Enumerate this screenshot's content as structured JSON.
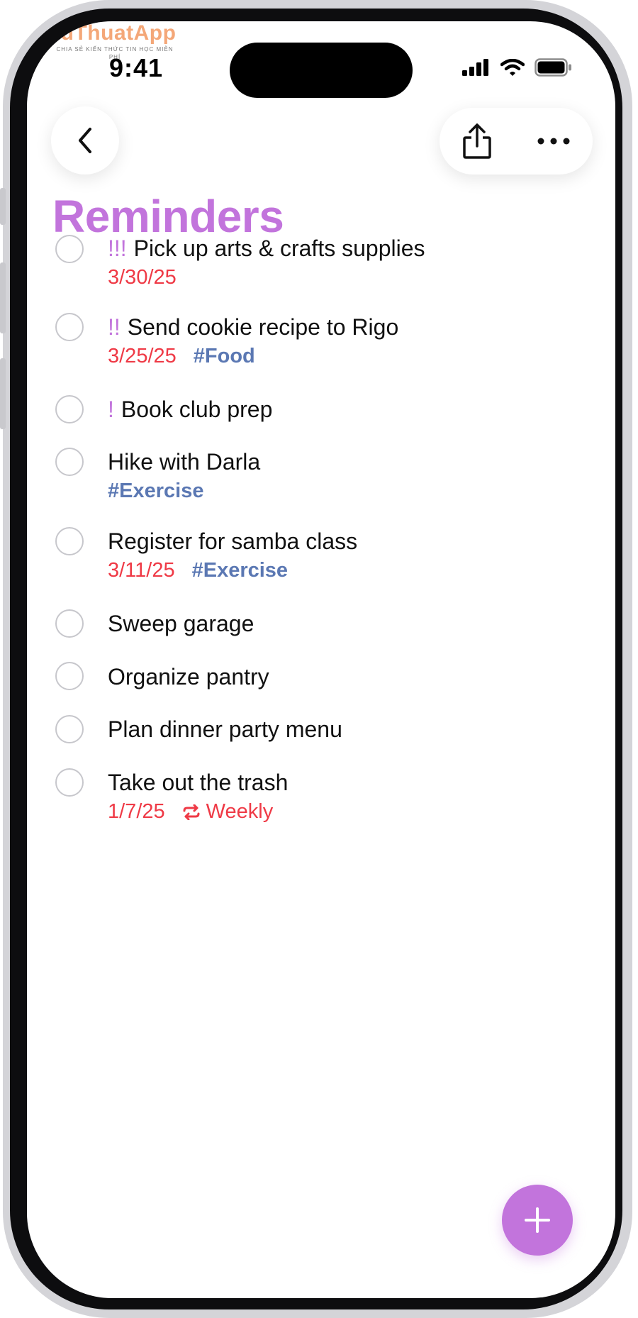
{
  "watermark": {
    "brand": "ThuThuatApp",
    "tagline": "CHIA SẺ KIẾN THỨC TIN HỌC MIỄN PHÍ"
  },
  "status_bar": {
    "time": "9:41"
  },
  "toolbar": {
    "back_icon": "chevron-left-icon",
    "share_icon": "share-icon",
    "more_icon": "ellipsis-icon"
  },
  "page": {
    "title": "Reminders"
  },
  "reminders": [
    {
      "priority": "!!!",
      "title": "Pick up arts & crafts supplies",
      "date": "3/30/25",
      "tag": ""
    },
    {
      "priority": "!!",
      "title": "Send cookie recipe to Rigo",
      "date": "3/25/25",
      "tag": "#Food"
    },
    {
      "priority": "!",
      "title": "Book club prep",
      "date": "",
      "tag": ""
    },
    {
      "priority": "",
      "title": "Hike with Darla",
      "date": "",
      "tag": "#Exercise"
    },
    {
      "priority": "",
      "title": "Register for samba class",
      "date": "3/11/25",
      "tag": "#Exercise"
    },
    {
      "priority": "",
      "title": "Sweep garage",
      "date": "",
      "tag": ""
    },
    {
      "priority": "",
      "title": "Organize pantry",
      "date": "",
      "tag": ""
    },
    {
      "priority": "",
      "title": "Plan dinner party menu",
      "date": "",
      "tag": ""
    },
    {
      "priority": "",
      "title": "Take out the trash",
      "date": "1/7/25",
      "tag": "",
      "repeat": "Weekly"
    }
  ],
  "fab": {
    "icon": "plus-icon"
  },
  "colors": {
    "accent": "#c274dc",
    "date": "#ef3a46",
    "tag": "#5b78b3"
  }
}
